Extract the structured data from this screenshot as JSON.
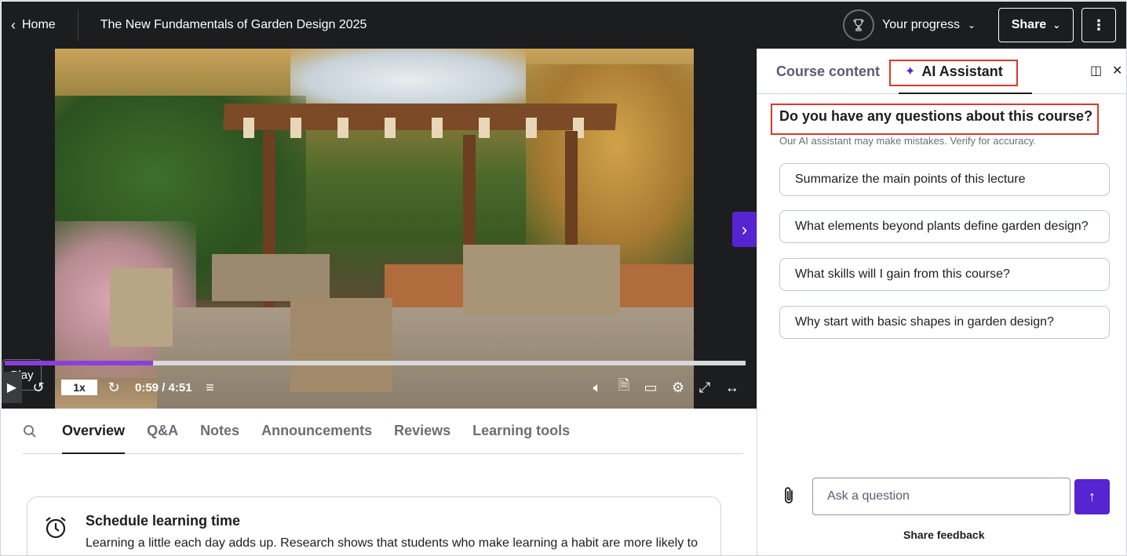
{
  "header": {
    "back_label": "Home",
    "course_title": "The New Fundamentals of Garden Design 2025",
    "progress_label": "Your progress",
    "share_label": "Share"
  },
  "video": {
    "play_tooltip": "Play",
    "playback_rate": "1x",
    "time": "0:59 / 4:51",
    "progress_fraction": 0.2,
    "accent_color": "#8b3fd9"
  },
  "tabs": [
    {
      "label": "Overview"
    },
    {
      "label": "Q&A"
    },
    {
      "label": "Notes"
    },
    {
      "label": "Announcements"
    },
    {
      "label": "Reviews"
    },
    {
      "label": "Learning tools"
    }
  ],
  "schedule": {
    "title": "Schedule learning time",
    "body": "Learning a little each day adds up. Research shows that students who make learning a habit are more likely to"
  },
  "panel": {
    "tab_course": "Course content",
    "tab_ai": "AI Assistant",
    "question": "Do you have any questions about this course?",
    "disclaimer": "Our AI assistant may make mistakes. Verify for accuracy.",
    "suggestions": [
      "Summarize the main points of this lecture",
      "What elements beyond plants define garden design?",
      "What skills will I gain from this course?",
      "Why start with basic shapes in garden design?"
    ],
    "input_placeholder": "Ask a question",
    "feedback_label": "Share feedback",
    "brand_color": "#5624d0"
  }
}
